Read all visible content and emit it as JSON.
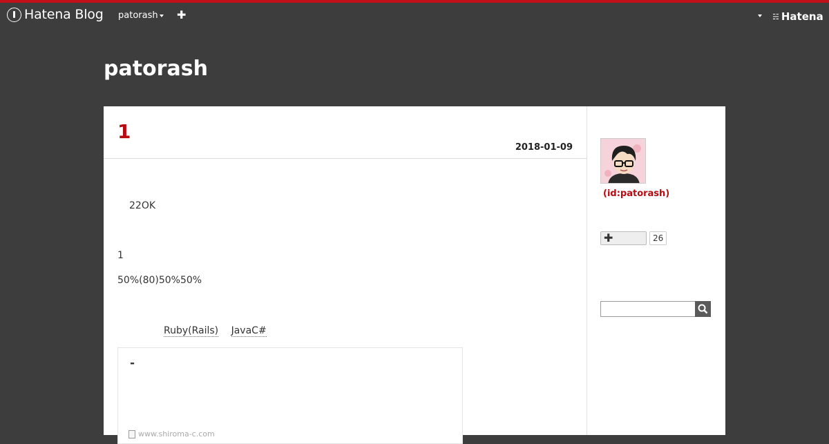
{
  "header": {
    "logo_text": "Hatena Blog",
    "user_menu": "patorash",
    "add_label": "✚",
    "hatena_label": "Hatena",
    "hatena_mark": "☵"
  },
  "blog": {
    "title": "patorash"
  },
  "entry": {
    "title": "1",
    "date": "2018-01-09",
    "paragraph1": "22OK",
    "paragraph2": "1",
    "paragraph3": "50%(80)50%50%",
    "links": [
      "Ruby(Rails)",
      "JavaC#"
    ],
    "card_title": "-",
    "card_source": "www.shiroma-c.com"
  },
  "sidebar": {
    "profile_id": "(id:patorash)",
    "follow_label": "✚",
    "follow_count": "26"
  },
  "colors": {
    "accent": "#b70b13",
    "top_border": "#c0101a",
    "background": "#3d3d3d"
  }
}
